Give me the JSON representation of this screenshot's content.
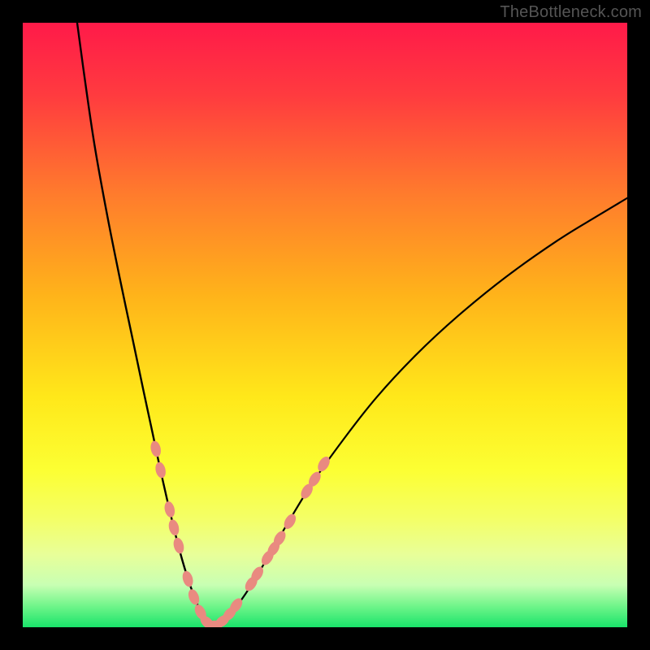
{
  "watermark": "TheBottleneck.com",
  "chart_data": {
    "type": "line",
    "title": "",
    "xlabel": "",
    "ylabel": "",
    "xlim": [
      0,
      100
    ],
    "ylim": [
      0,
      100
    ],
    "gradient_stops": [
      {
        "offset": 0.0,
        "color": "#ff1a49"
      },
      {
        "offset": 0.12,
        "color": "#ff3b3f"
      },
      {
        "offset": 0.28,
        "color": "#ff7a2d"
      },
      {
        "offset": 0.45,
        "color": "#ffb31a"
      },
      {
        "offset": 0.62,
        "color": "#ffe81a"
      },
      {
        "offset": 0.74,
        "color": "#fcff33"
      },
      {
        "offset": 0.82,
        "color": "#f4ff66"
      },
      {
        "offset": 0.88,
        "color": "#e8ff99"
      },
      {
        "offset": 0.93,
        "color": "#c8ffb3"
      },
      {
        "offset": 0.965,
        "color": "#70f58a"
      },
      {
        "offset": 1.0,
        "color": "#19e36a"
      }
    ],
    "series": [
      {
        "name": "left-branch",
        "x": [
          9.0,
          10.5,
          12.0,
          14.0,
          16.0,
          18.0,
          20.0,
          21.5,
          23.0,
          24.5,
          26.0,
          27.5,
          29.0,
          30.0,
          31.0
        ],
        "y": [
          100.0,
          89.0,
          79.0,
          68.0,
          58.0,
          48.5,
          39.0,
          32.0,
          25.0,
          18.5,
          12.5,
          7.5,
          3.5,
          1.2,
          0.0
        ]
      },
      {
        "name": "right-branch",
        "x": [
          31.0,
          33.0,
          35.0,
          37.5,
          40.5,
          44.0,
          48.0,
          53.0,
          58.5,
          65.0,
          72.0,
          80.0,
          88.5,
          95.0,
          100.0
        ],
        "y": [
          0.0,
          1.0,
          3.0,
          6.5,
          11.5,
          17.5,
          24.0,
          31.0,
          38.0,
          45.0,
          51.5,
          58.0,
          64.0,
          68.0,
          71.0
        ]
      }
    ],
    "markers": {
      "name": "highlighted-points",
      "color": "#e98a80",
      "radius_long": 10,
      "radius_short": 6,
      "points": [
        {
          "x": 22.0,
          "y": 29.5
        },
        {
          "x": 22.8,
          "y": 26.0
        },
        {
          "x": 24.3,
          "y": 19.5
        },
        {
          "x": 25.0,
          "y": 16.5
        },
        {
          "x": 25.8,
          "y": 13.5
        },
        {
          "x": 27.3,
          "y": 8.0
        },
        {
          "x": 28.3,
          "y": 5.0
        },
        {
          "x": 29.4,
          "y": 2.5
        },
        {
          "x": 30.5,
          "y": 0.8
        },
        {
          "x": 31.7,
          "y": 0.3
        },
        {
          "x": 33.0,
          "y": 1.0
        },
        {
          "x": 34.2,
          "y": 2.2
        },
        {
          "x": 35.3,
          "y": 3.6
        },
        {
          "x": 37.8,
          "y": 7.2
        },
        {
          "x": 38.8,
          "y": 8.8
        },
        {
          "x": 40.5,
          "y": 11.5
        },
        {
          "x": 41.5,
          "y": 13.0
        },
        {
          "x": 42.5,
          "y": 14.7
        },
        {
          "x": 44.2,
          "y": 17.5
        },
        {
          "x": 47.0,
          "y": 22.5
        },
        {
          "x": 48.3,
          "y": 24.5
        },
        {
          "x": 49.8,
          "y": 27.0
        }
      ]
    }
  }
}
